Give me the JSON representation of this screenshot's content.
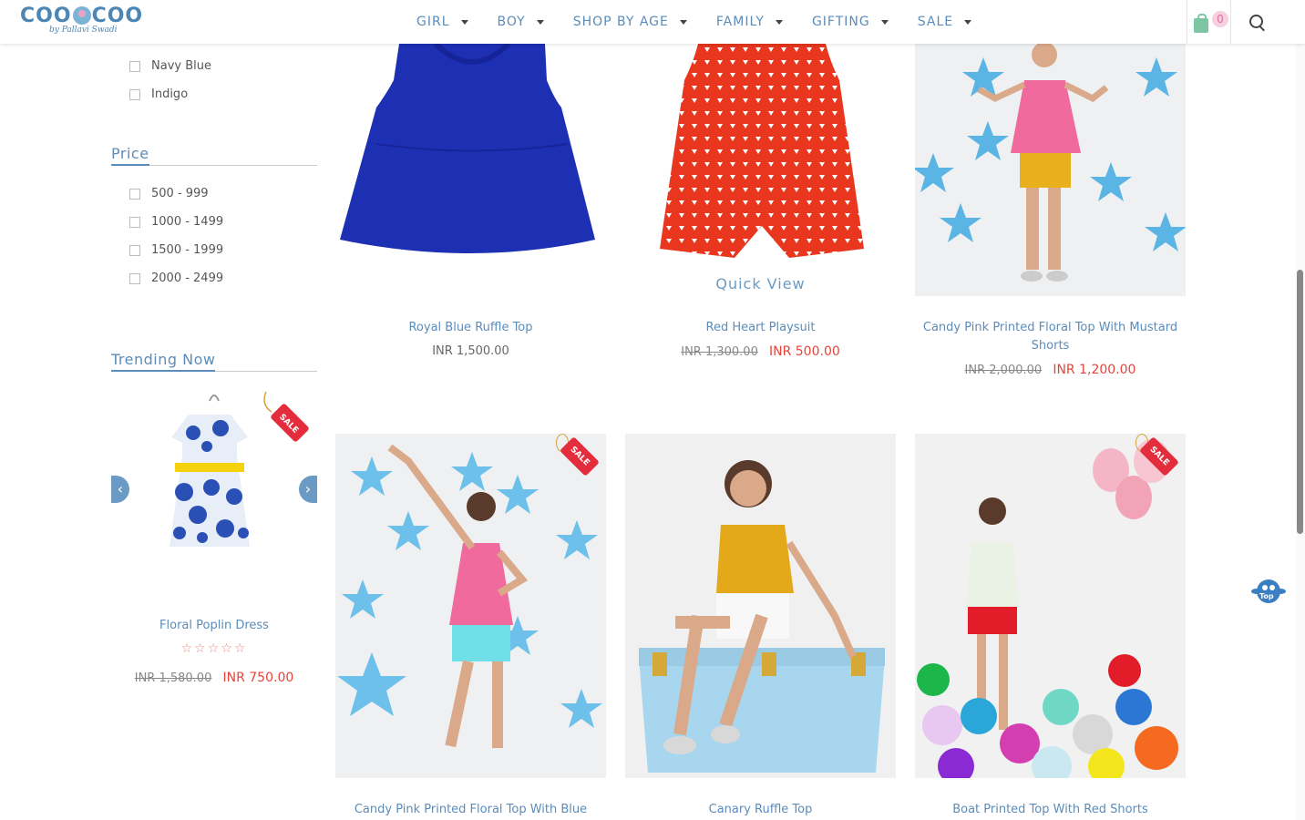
{
  "brand": {
    "name": "COOCOO",
    "tagline": "by Pallavi Swadi"
  },
  "nav": [
    {
      "label": "GIRL"
    },
    {
      "label": "BOY"
    },
    {
      "label": "SHOP BY AGE"
    },
    {
      "label": "FAMILY"
    },
    {
      "label": "GIFTING"
    },
    {
      "label": "SALE"
    }
  ],
  "cart": {
    "count": "0"
  },
  "filters": {
    "colors": [
      "Navy Blue",
      "Indigo"
    ],
    "price_title": "Price",
    "prices": [
      "500 - 999",
      "1000 - 1499",
      "1500 - 1999",
      "2000 - 2499"
    ]
  },
  "trending": {
    "title": "Trending Now",
    "name": "Floral Poplin Dress",
    "rating": "☆☆☆☆☆",
    "old_price": "INR 1,580.00",
    "new_price": "INR 750.00",
    "sale_label": "SALE"
  },
  "quick_view": "Quick View",
  "products": [
    {
      "name": "Royal Blue Ruffle Top",
      "price": "INR 1,500.00"
    },
    {
      "name": "Red Heart Playsuit",
      "old_price": "INR 1,300.00",
      "new_price": "INR 500.00"
    },
    {
      "name": "Candy Pink Printed Floral Top With Mustard Shorts",
      "old_price": "INR 2,000.00",
      "new_price": "INR 1,200.00"
    },
    {
      "name": "Candy Pink Printed Floral Top With Blue",
      "sale_label": "SALE"
    },
    {
      "name": "Canary Ruffle Top"
    },
    {
      "name": "Boat Printed Top With Red Shorts",
      "sale_label": "SALE"
    }
  ],
  "top_button": "Top",
  "colors": {
    "accent": "#5b8cba",
    "sale": "#e5443a",
    "tag": "#e42d3c"
  }
}
